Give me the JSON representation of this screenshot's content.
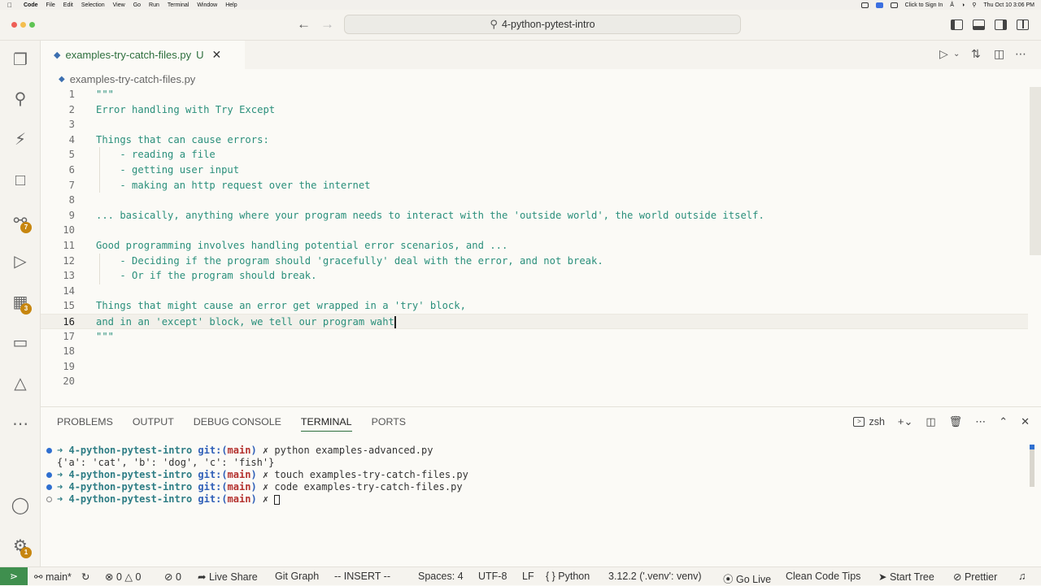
{
  "menubar": {
    "app": "Code",
    "items": [
      "File",
      "Edit",
      "Selection",
      "View",
      "Go",
      "Run",
      "Terminal",
      "Window",
      "Help"
    ],
    "sign_in": "Click to Sign In",
    "clock": "Thu Oct 10  3:06 PM"
  },
  "titlebar": {
    "search_text": "4-python-pytest-intro"
  },
  "activity_badges": {
    "source_control": "7",
    "extensions": "3",
    "accounts": "1"
  },
  "tab": {
    "filename": "examples-try-catch-files.py",
    "status": "U"
  },
  "breadcrumb": {
    "file": "examples-try-catch-files.py"
  },
  "editor": {
    "lines": [
      {
        "n": "1",
        "code": "\"\"\""
      },
      {
        "n": "2",
        "code": "Error handling with Try Except"
      },
      {
        "n": "3",
        "code": ""
      },
      {
        "n": "4",
        "code": "Things that can cause errors:"
      },
      {
        "n": "5",
        "code": "    - reading a file"
      },
      {
        "n": "6",
        "code": "    - getting user input"
      },
      {
        "n": "7",
        "code": "    - making an http request over the internet"
      },
      {
        "n": "8",
        "code": ""
      },
      {
        "n": "9",
        "code": "... basically, anything where your program needs to interact with the 'outside world', the world outside itself."
      },
      {
        "n": "10",
        "code": ""
      },
      {
        "n": "11",
        "code": "Good programming involves handling potential error scenarios, and ..."
      },
      {
        "n": "12",
        "code": "    - Deciding if the program should 'gracefully' deal with the error, and not break."
      },
      {
        "n": "13",
        "code": "    - Or if the program should break."
      },
      {
        "n": "14",
        "code": ""
      },
      {
        "n": "15",
        "code": "Things that might cause an error get wrapped in a 'try' block,"
      },
      {
        "n": "16",
        "code": "and in an 'except' block, we tell our program waht"
      },
      {
        "n": "17",
        "code": "\"\"\""
      },
      {
        "n": "18",
        "code": ""
      },
      {
        "n": "19",
        "code": ""
      },
      {
        "n": "20",
        "code": ""
      }
    ]
  },
  "panel": {
    "tabs": [
      "PROBLEMS",
      "OUTPUT",
      "DEBUG CONSOLE",
      "TERMINAL",
      "PORTS"
    ],
    "active_tab": "TERMINAL",
    "shell": "zsh",
    "terminal": [
      {
        "arrow": "➜",
        "dir": "4-python-pytest-intro",
        "git": "git:(",
        "branch": "main",
        "close": ")",
        "mark": "✗",
        "cmd": "python examples-advanced.py"
      },
      {
        "output": "{'a': 'cat', 'b': 'dog', 'c': 'fish'}"
      },
      {
        "arrow": "➜",
        "dir": "4-python-pytest-intro",
        "git": "git:(",
        "branch": "main",
        "close": ")",
        "mark": "✗",
        "cmd": "touch examples-try-catch-files.py"
      },
      {
        "arrow": "➜",
        "dir": "4-python-pytest-intro",
        "git": "git:(",
        "branch": "main",
        "close": ")",
        "mark": "✗",
        "cmd": "code examples-try-catch-files.py"
      },
      {
        "arrow": "➜",
        "dir": "4-python-pytest-intro",
        "git": "git:(",
        "branch": "main",
        "close": ")",
        "mark": "✗",
        "cmd": ""
      }
    ]
  },
  "statusbar": {
    "branch": "main*",
    "errors": "0",
    "warnings": "0",
    "ports": "0",
    "live_share": "Live Share",
    "git_graph": "Git Graph",
    "mode": "-- INSERT --",
    "spaces": "Spaces: 4",
    "encoding": "UTF-8",
    "eol": "LF",
    "language": "Python",
    "interpreter": "3.12.2 ('.venv': venv)",
    "go_live": "Go Live",
    "clean_code": "Clean Code Tips",
    "start_tree": "Start Tree",
    "prettier": "Prettier"
  },
  "colors": {
    "accent": "#2e6f3e",
    "code_text": "#2a8f7b",
    "badge": "#c7860f",
    "remote": "#3f8f4e"
  }
}
